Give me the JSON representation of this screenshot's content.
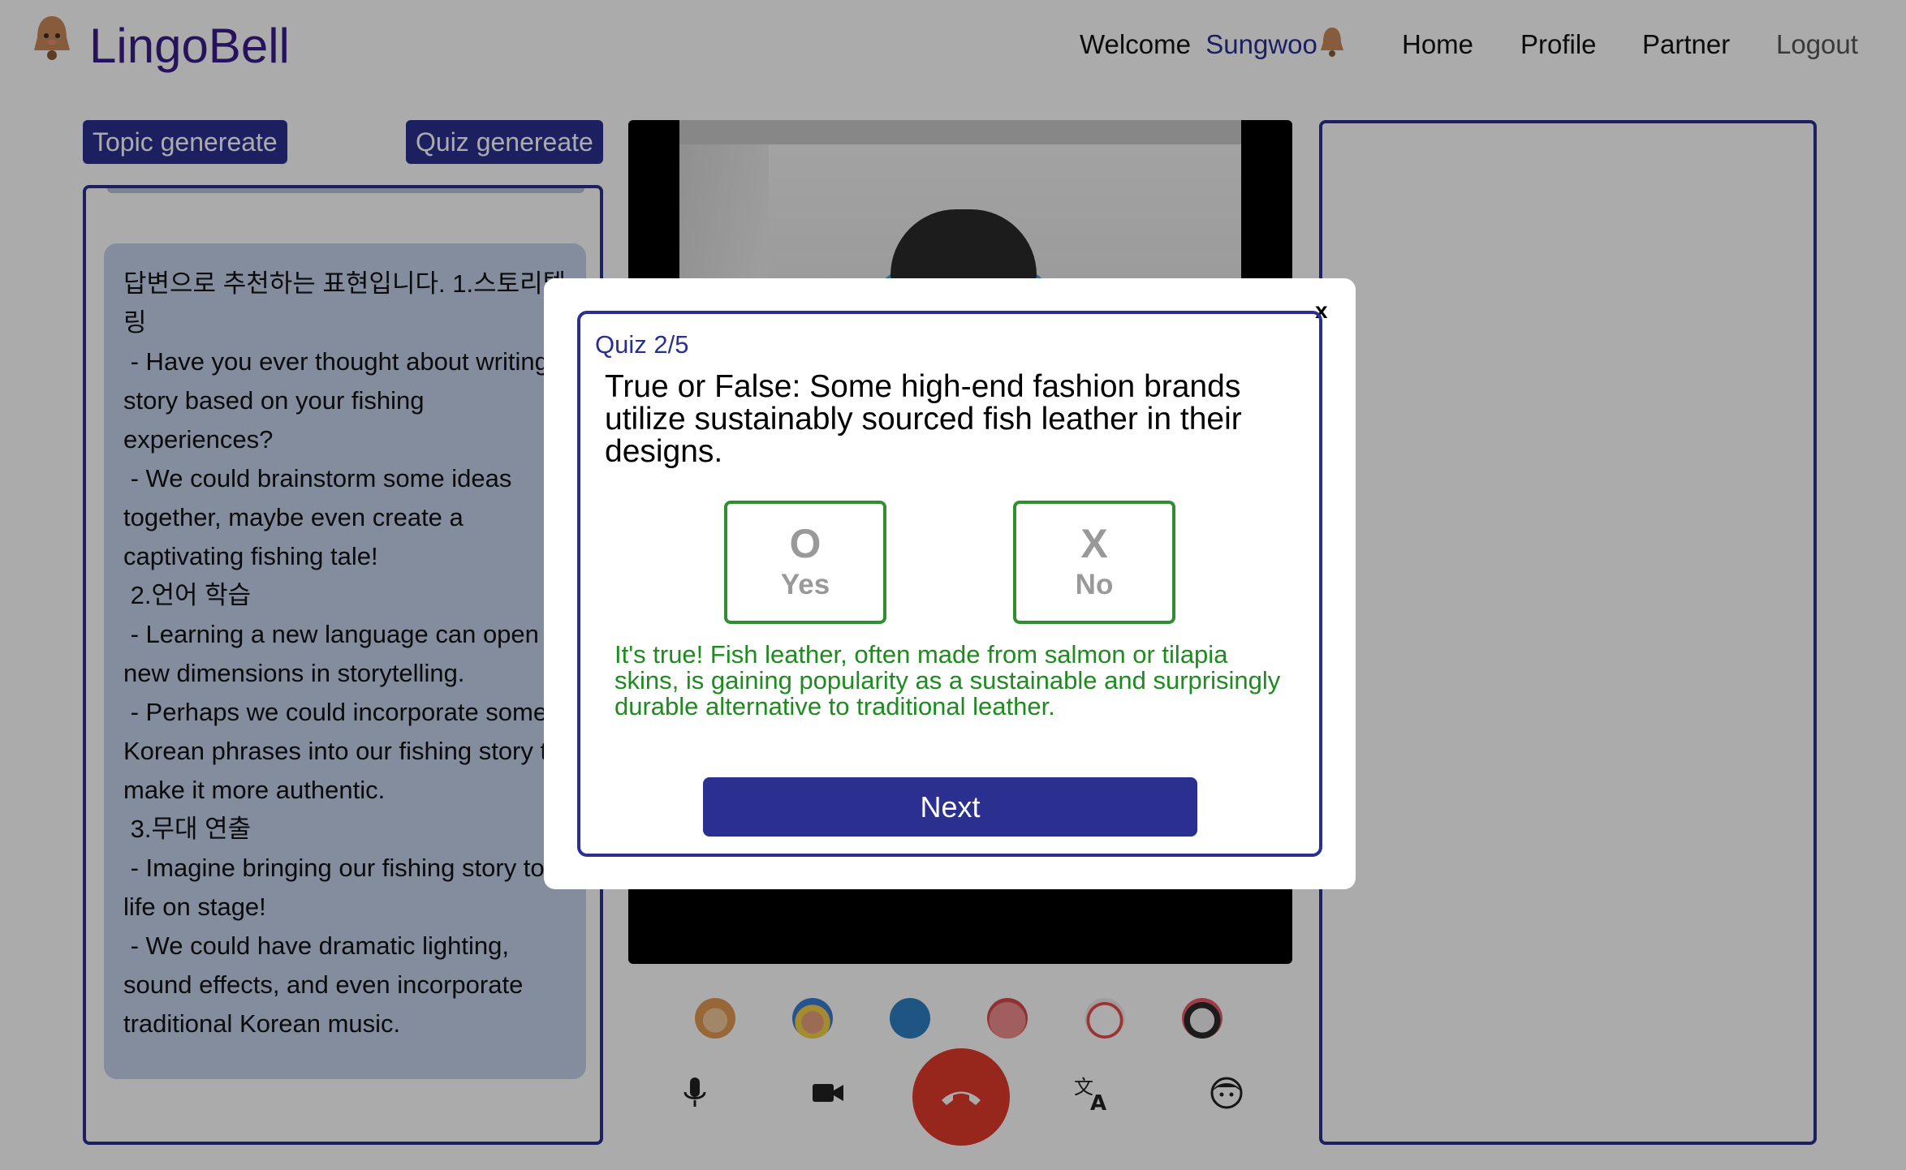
{
  "header": {
    "app_name": "LingoBell",
    "welcome_label": "Welcome",
    "user_name": "Sungwoo",
    "nav": {
      "home": "Home",
      "profile": "Profile",
      "partner": "Partner",
      "logout": "Logout"
    }
  },
  "left_panel": {
    "topic_button": "Topic genereate",
    "quiz_button": "Quiz genereate",
    "topic_text": "답변으로 추천하는 표현입니다. 1.스토리텔링\n - Have you ever thought about writing a story based on your fishing experiences?\n - We could brainstorm some ideas together, maybe even create a captivating fishing tale!\n 2.언어 학습\n - Learning a new language can open up new dimensions in storytelling.\n - Perhaps we could incorporate some Korean phrases into our fishing story to make it more authentic.\n 3.무대 연출\n - Imagine bringing our fishing story to life on stage!\n - We could have dramatic lighting, sound effects, and even incorporate traditional Korean music."
  },
  "filters": [
    "hamster-filter-icon",
    "sunhat-filter-icon",
    "seal-filter-icon",
    "crab-filter-icon",
    "mask-filter-icon",
    "joker-filter-icon"
  ],
  "controls": {
    "mic": "microphone-icon",
    "camera": "camera-icon",
    "end_call": "phone-hangup-icon",
    "translate": "translate-icon",
    "face": "face-icon"
  },
  "quiz": {
    "progress": "Quiz 2/5",
    "question": "True or False: Some high-end fashion brands utilize sustainably sourced fish leather in their designs.",
    "option_true_mark": "O",
    "option_true_label": "Yes",
    "option_false_mark": "X",
    "option_false_label": "No",
    "explanation": "It's true! Fish leather, often made from salmon or tilapia skins, is gaining popularity as a sustainable and surprisingly durable alternative to traditional leather.",
    "next_button": "Next",
    "close": "x"
  },
  "colors": {
    "brand": "#2b3090",
    "logo": "#3a1d8a",
    "correct": "#2f8f2f",
    "end_call": "#e23b2c",
    "topic_card_bg": "#c3d3ec"
  }
}
